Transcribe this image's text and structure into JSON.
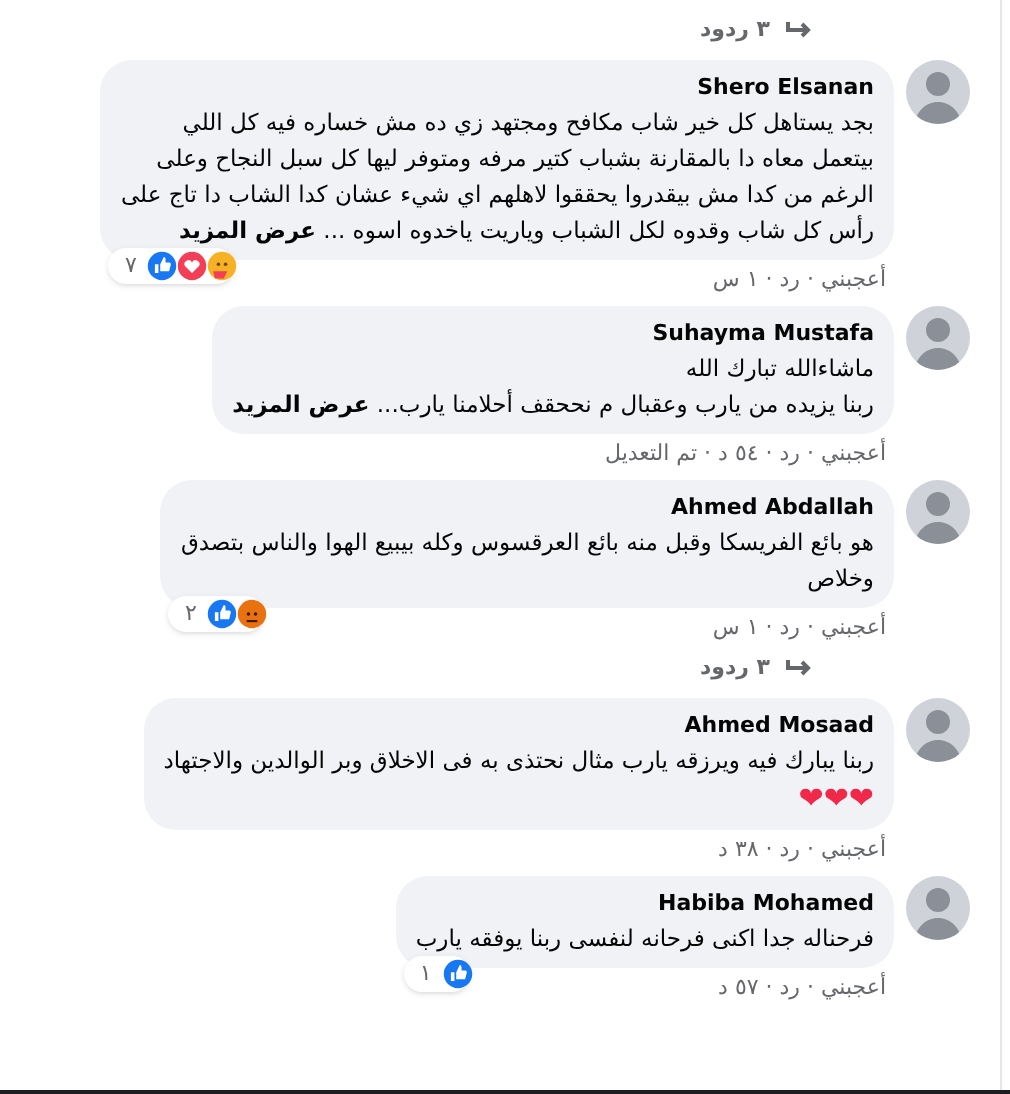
{
  "top_replies": {
    "label": "٣ ردود"
  },
  "comments": [
    {
      "author": "Shero Elsanan",
      "text": "بجد يستاهل كل خير شاب مكافح ومجتهد زي ده مش خساره فيه كل اللي\nبيتعمل معاه دا بالمقارنة بشباب كتير مرفه ومتوفر ليها كل سبل النجاح وعلى\nالرغم من كدا مش بيقدروا يحققوا لاهلهم اي شيء عشان كدا الشاب دا تاج على\nرأس كل شاب وقدوه لكل الشباب وياريت ياخدوه اسوه ...",
      "see_more": "عرض المزيد",
      "reactions": {
        "icons": [
          {
            "kind": "like"
          },
          {
            "kind": "love"
          },
          {
            "kind": "care"
          }
        ],
        "count": "٧"
      },
      "meta": "أعجبني · رد · ١ س"
    },
    {
      "author": "Suhayma Mustafa",
      "text": "ماشاءالله تبارك الله\nربنا يزيده من يارب وعقبال م نححقف أحلامنا يارب...",
      "see_more": "عرض المزيد",
      "meta": "أعجبني · رد · ٥٤ د · تم التعديل"
    },
    {
      "author": "Ahmed Abdallah",
      "text": "هو بائع الفريسكا وقبل منه بائع العرقسوس وكله بيبيع الهوا والناس بتصدق\nوخلاص",
      "reactions": {
        "icons": [
          {
            "kind": "like"
          },
          {
            "kind": "angry"
          }
        ],
        "count": "٢"
      },
      "meta": "أعجبني · رد · ١ س",
      "replies": "٣ ردود"
    },
    {
      "author": "Ahmed Mosaad",
      "text": "ربنا يبارك فيه ويرزقه يارب مثال نحتذى به فى الاخلاق وبر الوالدين والاجتهاد",
      "emoji": "❤❤❤",
      "meta": "أعجبني · رد · ٣٨ د"
    },
    {
      "author": "Habiba Mohamed",
      "text": "فرحناله جدا اكنى فرحانه لنفسى ربنا يوفقه يارب",
      "reactions": {
        "icons": [
          {
            "kind": "like"
          }
        ],
        "count": "١"
      },
      "meta": "أعجبني · رد · ٥٧ د"
    }
  ]
}
